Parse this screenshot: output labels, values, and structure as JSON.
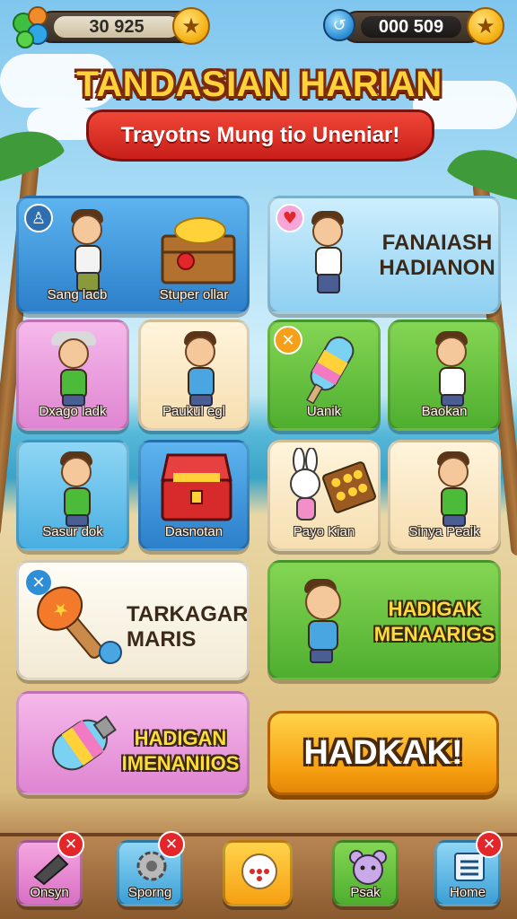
{
  "currency": {
    "left_value": "30 925",
    "right_value": "000 509",
    "left_icon": "gem-cluster-icon",
    "right_icon": "blue-coin-icon",
    "star_icon": "star-icon"
  },
  "banner": {
    "title": "TANDASIAN HARIAN",
    "subtitle": "Trayotns Mung tio Uneniar!"
  },
  "cards": [
    {
      "label": "Sang lacb",
      "icon": "running-kid-icon"
    },
    {
      "label": "Stuper ollar",
      "icon": "treasure-crate-icon"
    },
    {
      "label": "FANAIASH HADIANON",
      "icon": "heart-icon"
    },
    {
      "label": "Dxago ladk",
      "icon": "kid-with-hat-icon"
    },
    {
      "label": "Paukul egl",
      "icon": "kid-with-book-icon"
    },
    {
      "label": "Uanik",
      "icon": "popsicle-icon"
    },
    {
      "label": "Baokan",
      "icon": "kid-waving-icon"
    },
    {
      "label": "Sasur dok",
      "icon": "kid-with-phone-icon"
    },
    {
      "label": "Dasnotan",
      "icon": "red-chest-icon"
    },
    {
      "label": "Payo Kian",
      "icon": "bunny-with-box-icon"
    },
    {
      "label": "Sinya Peaik",
      "icon": "kid-with-card-icon"
    },
    {
      "label": "TARKAGAR MARIS",
      "icon": "rocket-torch-icon"
    },
    {
      "label": "HADIGAK MENAARIGS",
      "icon": "kid-with-letter-icon"
    },
    {
      "label": "HADIGAN IMENANIIOS",
      "icon": "capsule-icon"
    }
  ],
  "cta": {
    "label": "HADKAK!"
  },
  "nav": [
    {
      "label": "Onsyn",
      "icon": "horn-icon",
      "badge": "✕"
    },
    {
      "label": "Sporng",
      "icon": "gear-icon",
      "badge": "✕"
    },
    {
      "label": "",
      "icon": "dice-icon",
      "badge": ""
    },
    {
      "label": "Psak",
      "icon": "pet-icon",
      "badge": ""
    },
    {
      "label": "Home",
      "icon": "list-icon",
      "badge": "✕"
    }
  ],
  "colors": {
    "accent": "#f7a012",
    "banner_red": "#d62a22",
    "title_yellow": "#ffd23a"
  }
}
